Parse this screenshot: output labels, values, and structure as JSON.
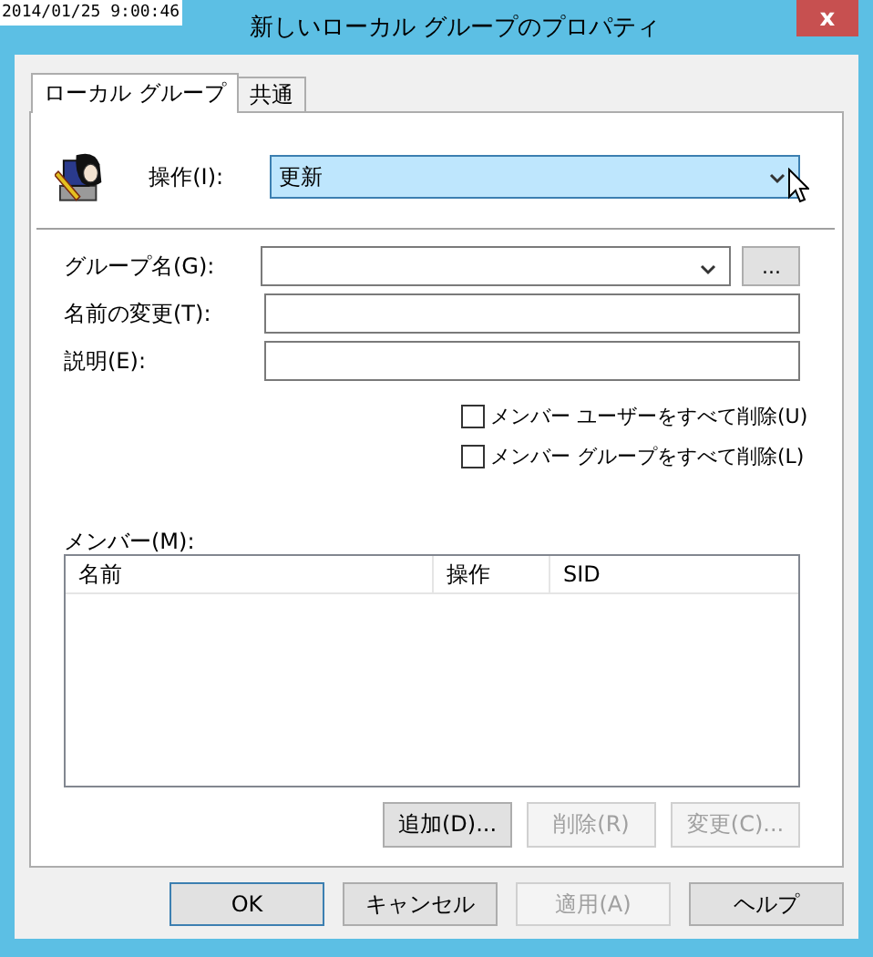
{
  "timestamp": "2014/01/25 9:00:46",
  "window": {
    "title": "新しいローカル グループのプロパティ",
    "close": "x"
  },
  "tabs": [
    {
      "label": "ローカル グループ",
      "selected": true
    },
    {
      "label": "共通",
      "selected": false
    }
  ],
  "action": {
    "label": "操作(I):",
    "value": "更新"
  },
  "fields": [
    {
      "kind": "combo",
      "label": "グループ名(G):",
      "browse": "..."
    },
    {
      "kind": "text",
      "label": "名前の変更(T):"
    },
    {
      "kind": "text",
      "label": "説明(E):"
    }
  ],
  "checkboxes": [
    {
      "label": "メンバー ユーザーをすべて削除(U)",
      "checked": false
    },
    {
      "label": "メンバー グループをすべて削除(L)",
      "checked": false
    }
  ],
  "members": {
    "label": "メンバー(M):",
    "columns": [
      "名前",
      "操作",
      "SID"
    ]
  },
  "member_buttons": [
    {
      "label": "追加(D)...",
      "disabled": false
    },
    {
      "label": "削除(R)",
      "disabled": true
    },
    {
      "label": "変更(C)...",
      "disabled": true
    }
  ],
  "dialog_buttons": [
    {
      "label": "OK",
      "disabled": false,
      "default": true
    },
    {
      "label": "キャンセル",
      "disabled": false,
      "default": false
    },
    {
      "label": "適用(A)",
      "disabled": true,
      "default": false
    },
    {
      "label": "ヘルプ",
      "disabled": false,
      "default": false
    }
  ]
}
